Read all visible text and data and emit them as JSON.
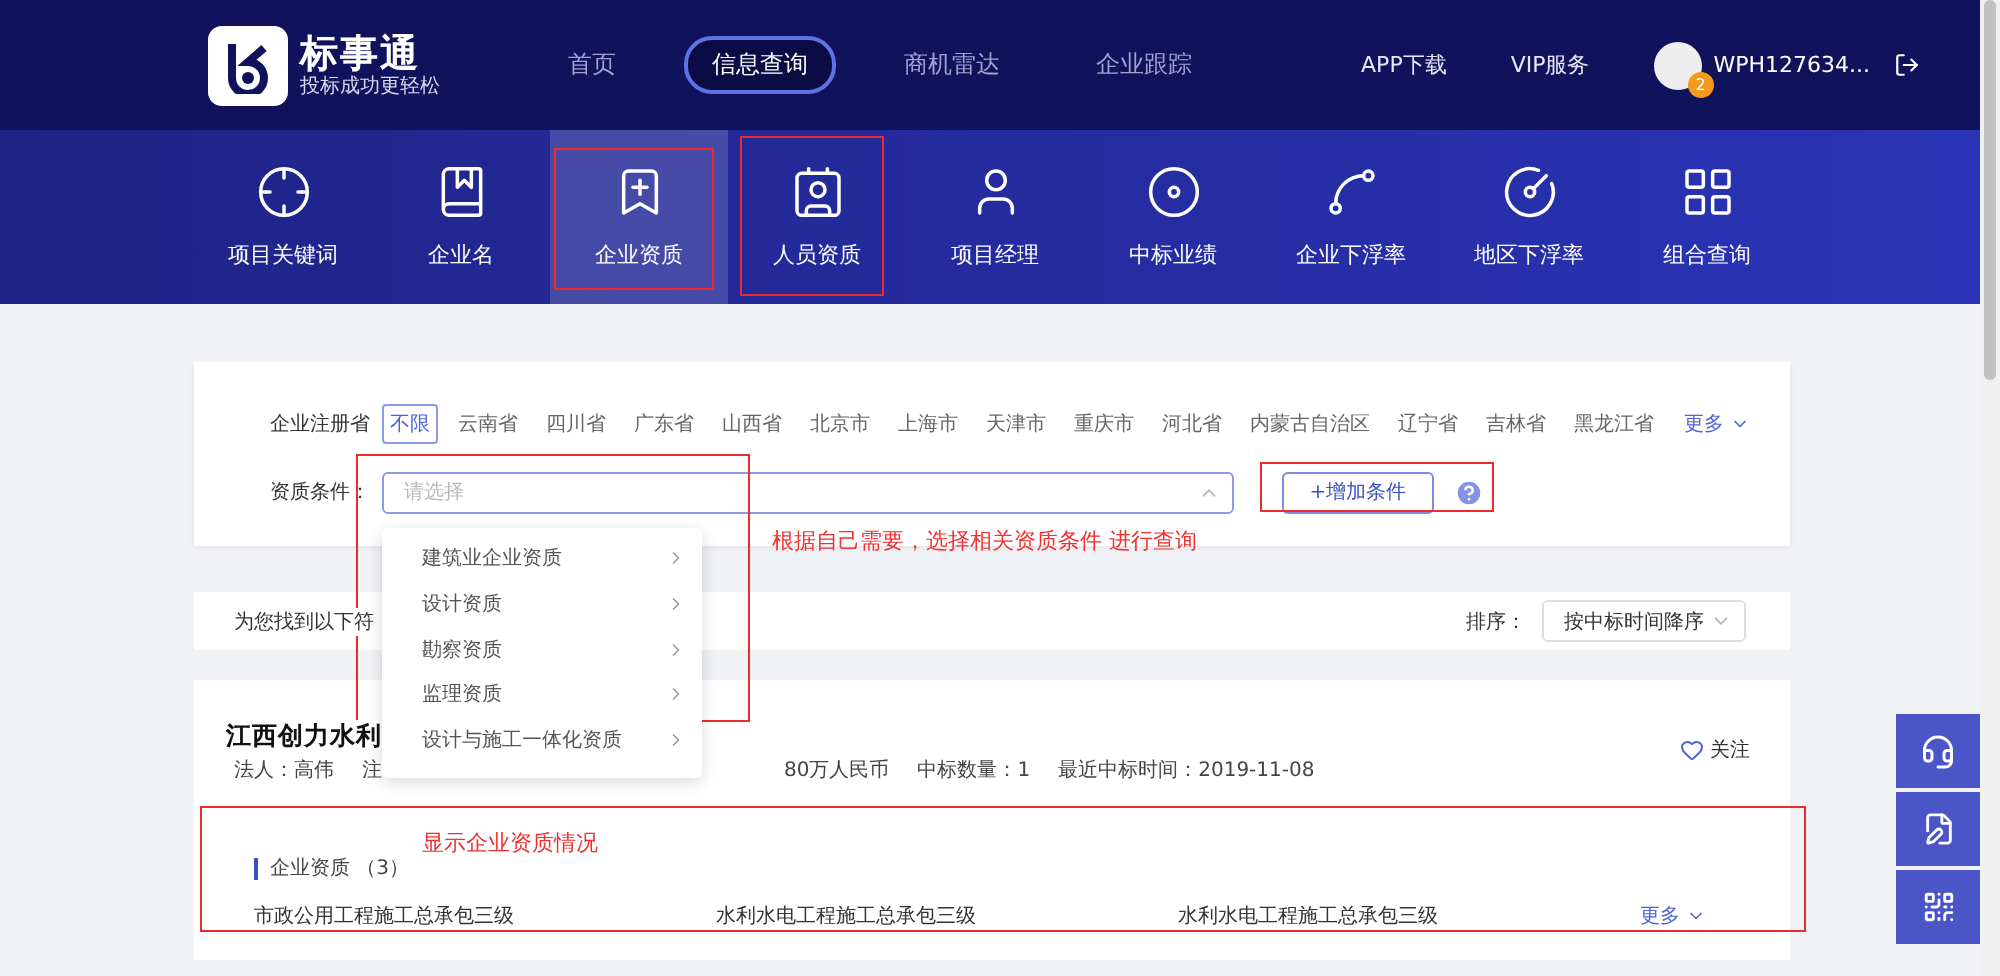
{
  "header": {
    "logo": {
      "name": "标事通",
      "slogan": "投标成功更轻松"
    },
    "nav": [
      {
        "label": "首页",
        "selected": false
      },
      {
        "label": "信息查询",
        "selected": true
      },
      {
        "label": "商机雷达",
        "selected": false
      },
      {
        "label": "企业跟踪",
        "selected": false
      }
    ],
    "links": [
      "APP下载",
      "VIP服务"
    ],
    "user": {
      "badge": "2",
      "name": "WPH127634..."
    }
  },
  "categories": [
    {
      "label": "项目关键词",
      "selected": false
    },
    {
      "label": "企业名",
      "selected": false
    },
    {
      "label": "企业资质",
      "selected": true
    },
    {
      "label": "人员资质",
      "selected": false
    },
    {
      "label": "项目经理",
      "selected": false
    },
    {
      "label": "中标业绩",
      "selected": false
    },
    {
      "label": "企业下浮率",
      "selected": false
    },
    {
      "label": "地区下浮率",
      "selected": false
    },
    {
      "label": "组合查询",
      "selected": false
    }
  ],
  "filter": {
    "province_label": "企业注册省",
    "provinces": [
      {
        "label": "不限",
        "selected": true
      },
      {
        "label": "云南省",
        "selected": false
      },
      {
        "label": "四川省",
        "selected": false
      },
      {
        "label": "广东省",
        "selected": false
      },
      {
        "label": "山西省",
        "selected": false
      },
      {
        "label": "北京市",
        "selected": false
      },
      {
        "label": "上海市",
        "selected": false
      },
      {
        "label": "天津市",
        "selected": false
      },
      {
        "label": "重庆市",
        "selected": false
      },
      {
        "label": "河北省",
        "selected": false
      },
      {
        "label": "内蒙古自治区",
        "selected": false
      },
      {
        "label": "辽宁省",
        "selected": false
      },
      {
        "label": "吉林省",
        "selected": false
      },
      {
        "label": "黑龙江省",
        "selected": false
      }
    ],
    "more": "更多",
    "qualification_label": "资质条件：",
    "select": {
      "placeholder": "请选择",
      "expanded": true
    },
    "add_button": "+增加条件",
    "dropdown": [
      "建筑业企业资质",
      "设计资质",
      "勘察资质",
      "监理资质",
      "设计与施工一体化资质"
    ]
  },
  "results": {
    "summary": "为您找到以下符",
    "sort_label": "排序：",
    "sort_value": "按中标时间降序"
  },
  "company": {
    "title": "江西创力水利",
    "meta_left": [
      "法人：高伟",
      "注"
    ],
    "meta_right": [
      "80万人民币",
      "中标数量：1",
      "最近中标时间：2019-11-08"
    ],
    "follow": "关注",
    "qualifications": {
      "title": "企业资质 （3）",
      "items": [
        "市政公用工程施工总承包三级",
        "水利水电工程施工总承包三级",
        "水利水电工程施工总承包三级"
      ],
      "more": "更多"
    }
  },
  "annotations": [
    {
      "text": "根据自己需要，选择相关资质条件 进行查询"
    },
    {
      "text": "显示企业资质情况"
    }
  ]
}
